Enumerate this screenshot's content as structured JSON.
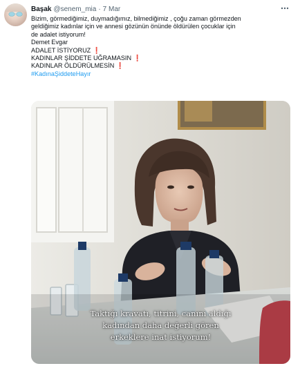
{
  "tweet": {
    "author_name": "Başak",
    "handle": "@senem_mia",
    "separator": "·",
    "date": "7 Mar",
    "more_icon": "ellipsis-icon",
    "text_lines": [
      "Bizim, görmediğimiz, duymadığımız, bilmediğimiz , çoğu zaman görmezden",
      "geldiğimiz kadınlar için ve annesi gözünün önünde öldürülen çocuklar için",
      "de adalet istiyorum!",
      "Demet Evgar"
    ],
    "shout_lines": [
      "ADALET İSTİYORUZ",
      "KADINLAR ŞİDDETE UĞRAMASIN",
      "KADINLAR ÖLDÜRÜLMESİN"
    ],
    "exclamation": "❗",
    "hashtag": "#KadınaŞiddeteHayır"
  },
  "video": {
    "subtitle_lines": [
      "Taktığı kravatı, titrini, canını aldığı",
      "kadından daha değerli gören",
      "erkeklere inat istiyorum!"
    ]
  },
  "colors": {
    "text": "#0f1419",
    "muted": "#536471",
    "link": "#1d9bf0",
    "exclamation": "#d0021b"
  }
}
